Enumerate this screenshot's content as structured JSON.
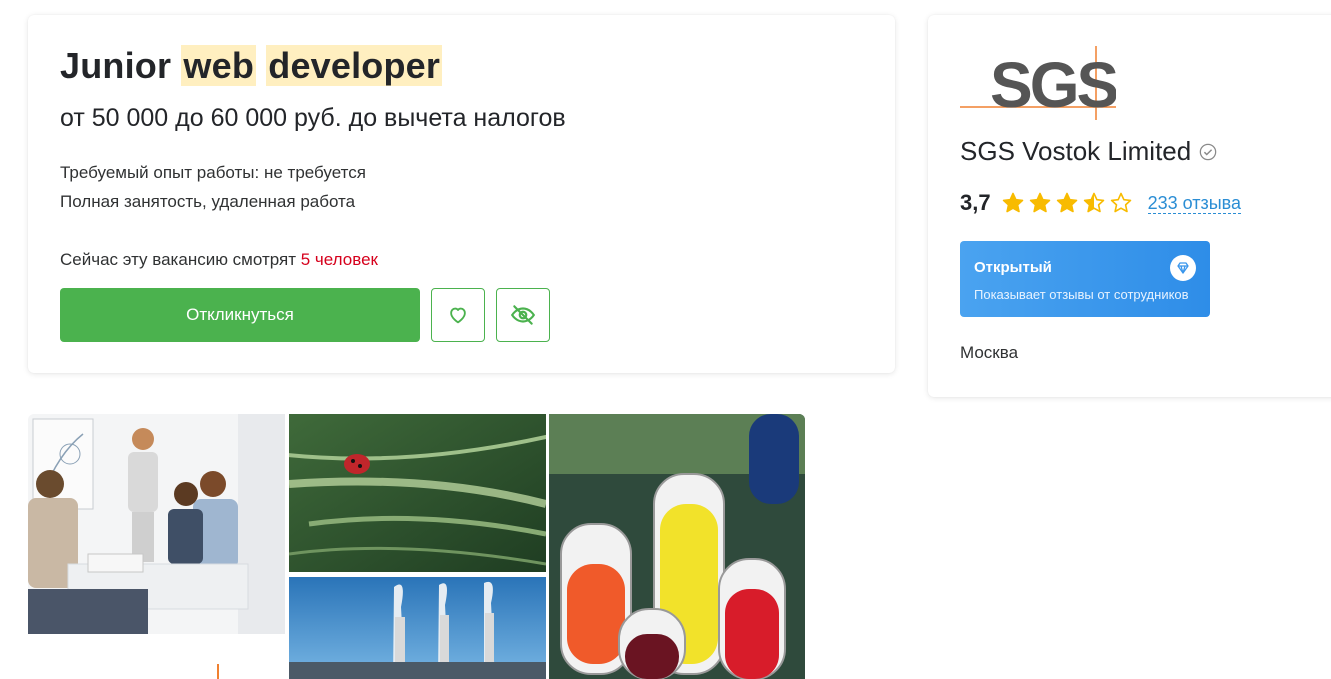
{
  "vacancy": {
    "title_prefix": "Junior",
    "title_hl1": "web",
    "title_hl2": "developer",
    "salary": "от 50 000 до 60 000 руб. до вычета налогов",
    "experience": "Требуемый опыт работы: не требуется",
    "employment": "Полная занятость, удаленная работа",
    "watching_prefix": "Сейчас эту вакансию смотрят",
    "watching_count": "5 человек",
    "apply_label": "Откликнуться",
    "favorite_icon": "heart-icon",
    "hide_icon": "eye-off-icon"
  },
  "company": {
    "logo_text": "SGS",
    "name": "SGS Vostok Limited",
    "rating": "3,7",
    "rating_value": 3.7,
    "stars_max": 5,
    "reviews": "233 отзыва",
    "badge_title": "Открытый",
    "badge_subtitle": "Показывает отзывы от сотрудников",
    "city": "Москва"
  },
  "colors": {
    "accent_green": "#4bb24e",
    "link_blue": "#2a8dd4",
    "highlight": "#ffefc0",
    "star": "#f8bb00",
    "red": "#d6001c"
  }
}
